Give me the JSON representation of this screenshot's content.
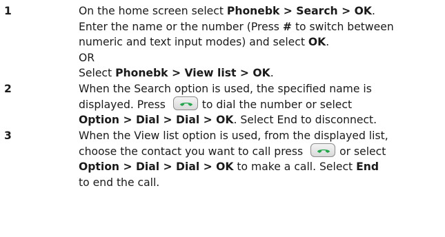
{
  "steps": [
    {
      "number": "1",
      "lines": [
        {
          "t1": "On the home screen select ",
          "b1": "Phonebk > Search > OK",
          "t2": "."
        },
        {
          "t1": "Enter the name or the number (Press ",
          "b1": "#",
          "t2": " to switch between"
        },
        {
          "t1": "numeric and text input modes) and select ",
          "b1": "OK",
          "t2": "."
        },
        {
          "t1": "OR"
        },
        {
          "t1": "Select ",
          "b1": "Phonebk > View list > OK",
          "t2": "."
        }
      ]
    },
    {
      "number": "2",
      "lines": [
        {
          "t1": "When the Search option is used, the specified name is"
        },
        {
          "t1": "displayed. Press ",
          "icon": "call-key-icon",
          "t2": "to dial the number or select"
        },
        {
          "b1": "Option > Dial > Dial > OK",
          "t2": ". Select End to disconnect."
        }
      ]
    },
    {
      "number": "3",
      "lines": [
        {
          "t1": "When the View list option is used, from the displayed list,"
        },
        {
          "t1": "choose the contact you want to call press ",
          "icon": "call-key-icon",
          "t2": "or select"
        },
        {
          "b1": "Option > Dial > Dial > OK",
          "t2": " to make a call. Select ",
          "b2": "End"
        },
        {
          "t1": "to end the call."
        }
      ]
    }
  ],
  "colors": {
    "call_icon": "#1fa84a",
    "text": "#1a1a1a"
  }
}
